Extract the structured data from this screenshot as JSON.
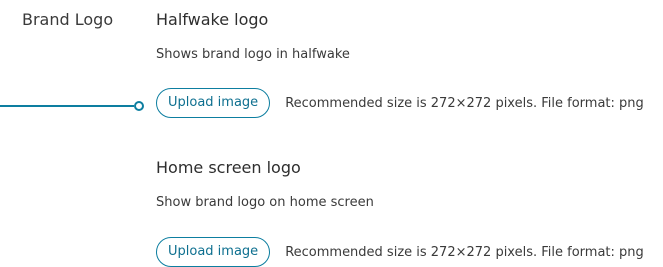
{
  "section": {
    "label": "Brand Logo"
  },
  "halfwake": {
    "title": "Halfwake logo",
    "description": "Shows brand logo in halfwake",
    "upload_label": "Upload image",
    "hint": "Recommended size is 272×272 pixels. File format: png"
  },
  "home_screen": {
    "title": "Home screen logo",
    "description": "Show brand logo on home screen",
    "upload_label": "Upload image",
    "hint": "Recommended size is 272×272 pixels. File format: png"
  },
  "colors": {
    "accent": "#0d7ea0",
    "text": "#2e2e2e"
  }
}
